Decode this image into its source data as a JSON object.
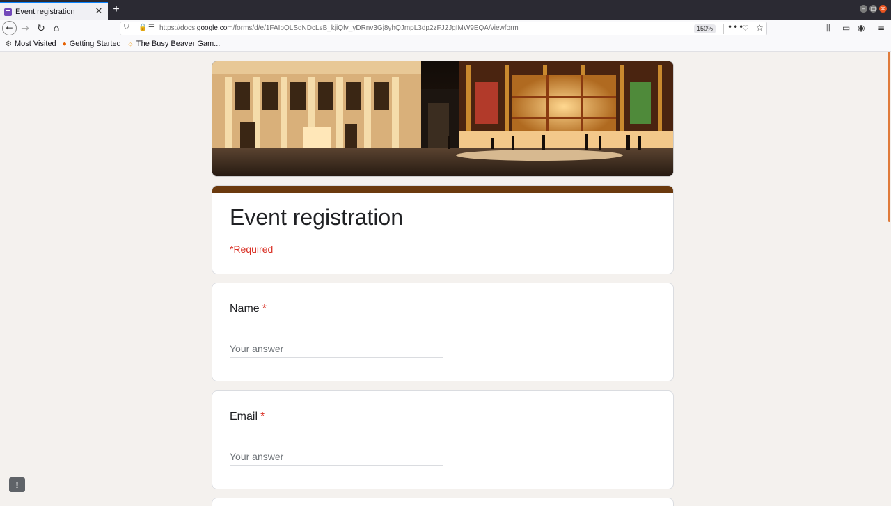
{
  "browser": {
    "tab": {
      "title": "Event registration",
      "close": "✕"
    },
    "new_tab": "+",
    "window": {
      "min": "–",
      "max": "□",
      "close": "✕"
    },
    "nav": {
      "back": "←",
      "forward": "→",
      "reload": "↻",
      "home": "⌂"
    },
    "url": {
      "prefix": "https://docs.",
      "domain": "google.com",
      "path": "/forms/d/e/1FAIpQLSdNDcLsB_kjiQfv_yDRnv3Gj8yhQJmpL3dp2zFJ2JgIMW9EQA/viewform",
      "zoom": "150%"
    },
    "bookmarks": [
      {
        "label": "Most Visited",
        "icon": "gear-icon",
        "glyph": "⚙"
      },
      {
        "label": "Getting Started",
        "icon": "firefox-icon",
        "glyph": "●"
      },
      {
        "label": "The Busy Beaver Gam...",
        "icon": "sun-icon",
        "glyph": "☼"
      }
    ],
    "icons": {
      "shield": "⛉",
      "lock": "🔒",
      "permissions": "☰",
      "more": "•••",
      "pocket": "♡",
      "star": "☆",
      "library": "⫼",
      "sidebar": "▭",
      "account": "◉",
      "menu": "≡"
    }
  },
  "form": {
    "title": "Event registration",
    "required_note": "*Required",
    "banner_alt": "Lincoln Center plaza at night",
    "accent_color": "#6b3a0e",
    "questions": [
      {
        "label": "Name",
        "required_mark": "*",
        "placeholder": "Your answer"
      },
      {
        "label": "Email",
        "required_mark": "*",
        "placeholder": "Your answer"
      }
    ]
  },
  "feedback": {
    "label": "!"
  }
}
